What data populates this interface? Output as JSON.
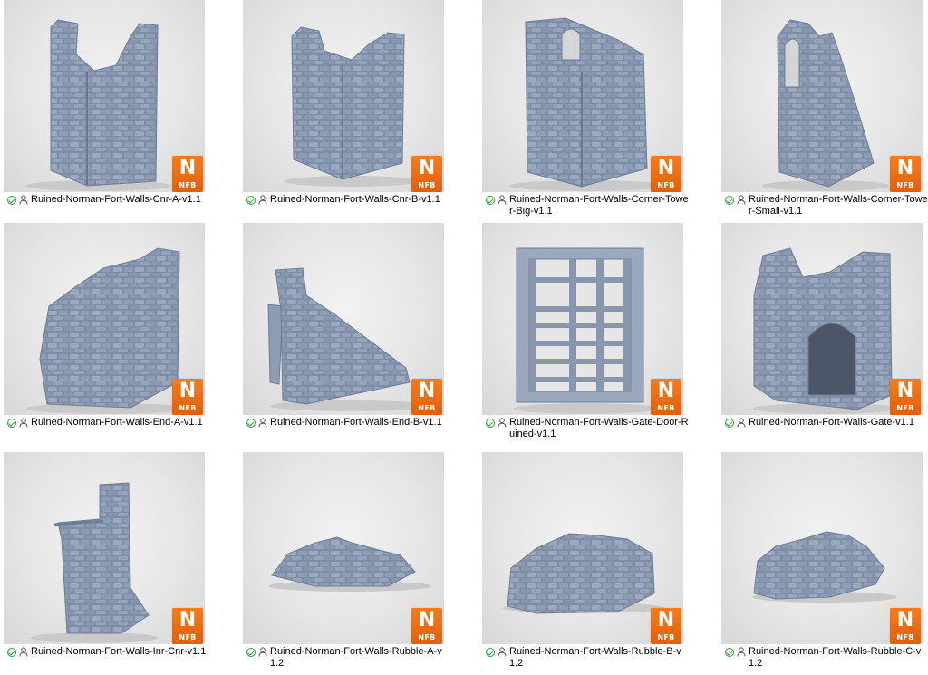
{
  "badge": {
    "letter": "N",
    "text": "NFB",
    "color": "#f07018"
  },
  "status_icon": "sync-ok-icon",
  "status_color": "#2d9f3a",
  "shared_icon": "person-icon",
  "files": [
    {
      "name": "Ruined-Norman-Fort-Walls-Cnr-A-v1.1",
      "model": "corner-wall"
    },
    {
      "name": "Ruined-Norman-Fort-Walls-Cnr-B-v1.1",
      "model": "corner-wall"
    },
    {
      "name": "Ruined-Norman-Fort-Walls-Corner-Tower-Big-v1.1",
      "model": "tower-big"
    },
    {
      "name": "Ruined-Norman-Fort-Walls-Corner-Tower-Small-v1.1",
      "model": "tower-small"
    },
    {
      "name": "Ruined-Norman-Fort-Walls-End-A-v1.1",
      "model": "wall-end"
    },
    {
      "name": "Ruined-Norman-Fort-Walls-End-B-v1.1",
      "model": "wall-slope"
    },
    {
      "name": "Ruined-Norman-Fort-Walls-Gate-Door-Ruined-v1.1",
      "model": "gate-door"
    },
    {
      "name": "Ruined-Norman-Fort-Walls-Gate-v1.1",
      "model": "gate-arch"
    },
    {
      "name": "Ruined-Norman-Fort-Walls-Inr-Cnr-v1.1",
      "model": "inner-corner"
    },
    {
      "name": "Ruined-Norman-Fort-Walls-Rubble-A-v1.2",
      "model": "rubble"
    },
    {
      "name": "Ruined-Norman-Fort-Walls-Rubble-B-v1.2",
      "model": "rubble"
    },
    {
      "name": "Ruined-Norman-Fort-Walls-Rubble-C-v1.2",
      "model": "rubble"
    }
  ]
}
